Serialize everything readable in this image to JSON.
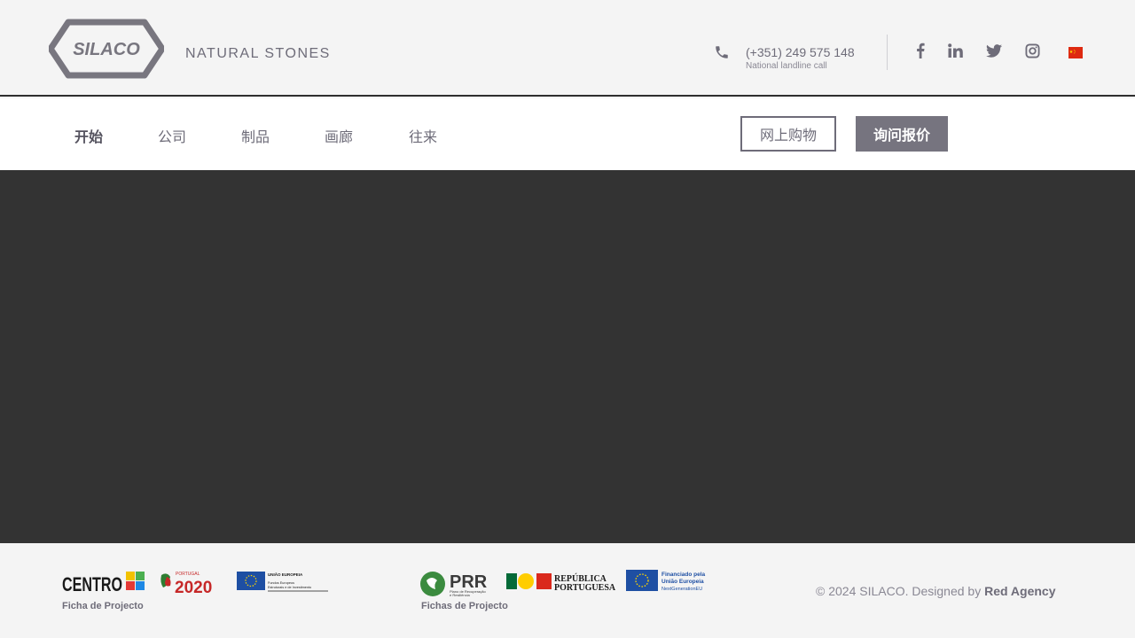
{
  "header": {
    "brand_logo_text": "SILACO",
    "tagline": "NATURAL STONES",
    "phone_number": "(+351) 249 575 148",
    "phone_note": "National landline call",
    "social_icons": [
      "facebook-icon",
      "linkedin-icon",
      "twitter-icon",
      "instagram-icon"
    ],
    "language_flag": "china-flag-icon"
  },
  "nav": {
    "items": [
      {
        "label": "开始",
        "active": true
      },
      {
        "label": "公司",
        "active": false
      },
      {
        "label": "制品",
        "active": false
      },
      {
        "label": "画廊",
        "active": false
      },
      {
        "label": "往来",
        "active": false
      }
    ],
    "shop_label": "网上购物",
    "quote_label": "询问报价"
  },
  "footer": {
    "group1_caption": "Ficha de Projecto",
    "group1_logos": [
      "CENTRO2020",
      "PORTUGAL 2020",
      "UNIÃO EUROPEIA Fundos Europeus Estruturais e de Investimento"
    ],
    "group2_caption": "Fichas de Projecto",
    "group2_logos": [
      "PRR Plano de Recuperação e Resiliência",
      "REPÚBLICA PORTUGUESA",
      "Financiado pela União Europeia NextGenerationEU"
    ],
    "copyright_prefix": "© 2024 SILACO. Designed by ",
    "designer": "Red Agency"
  },
  "colors": {
    "accent": "#6e6c79",
    "hero_bg": "#333333",
    "quote_button_bg": "#76747f"
  }
}
